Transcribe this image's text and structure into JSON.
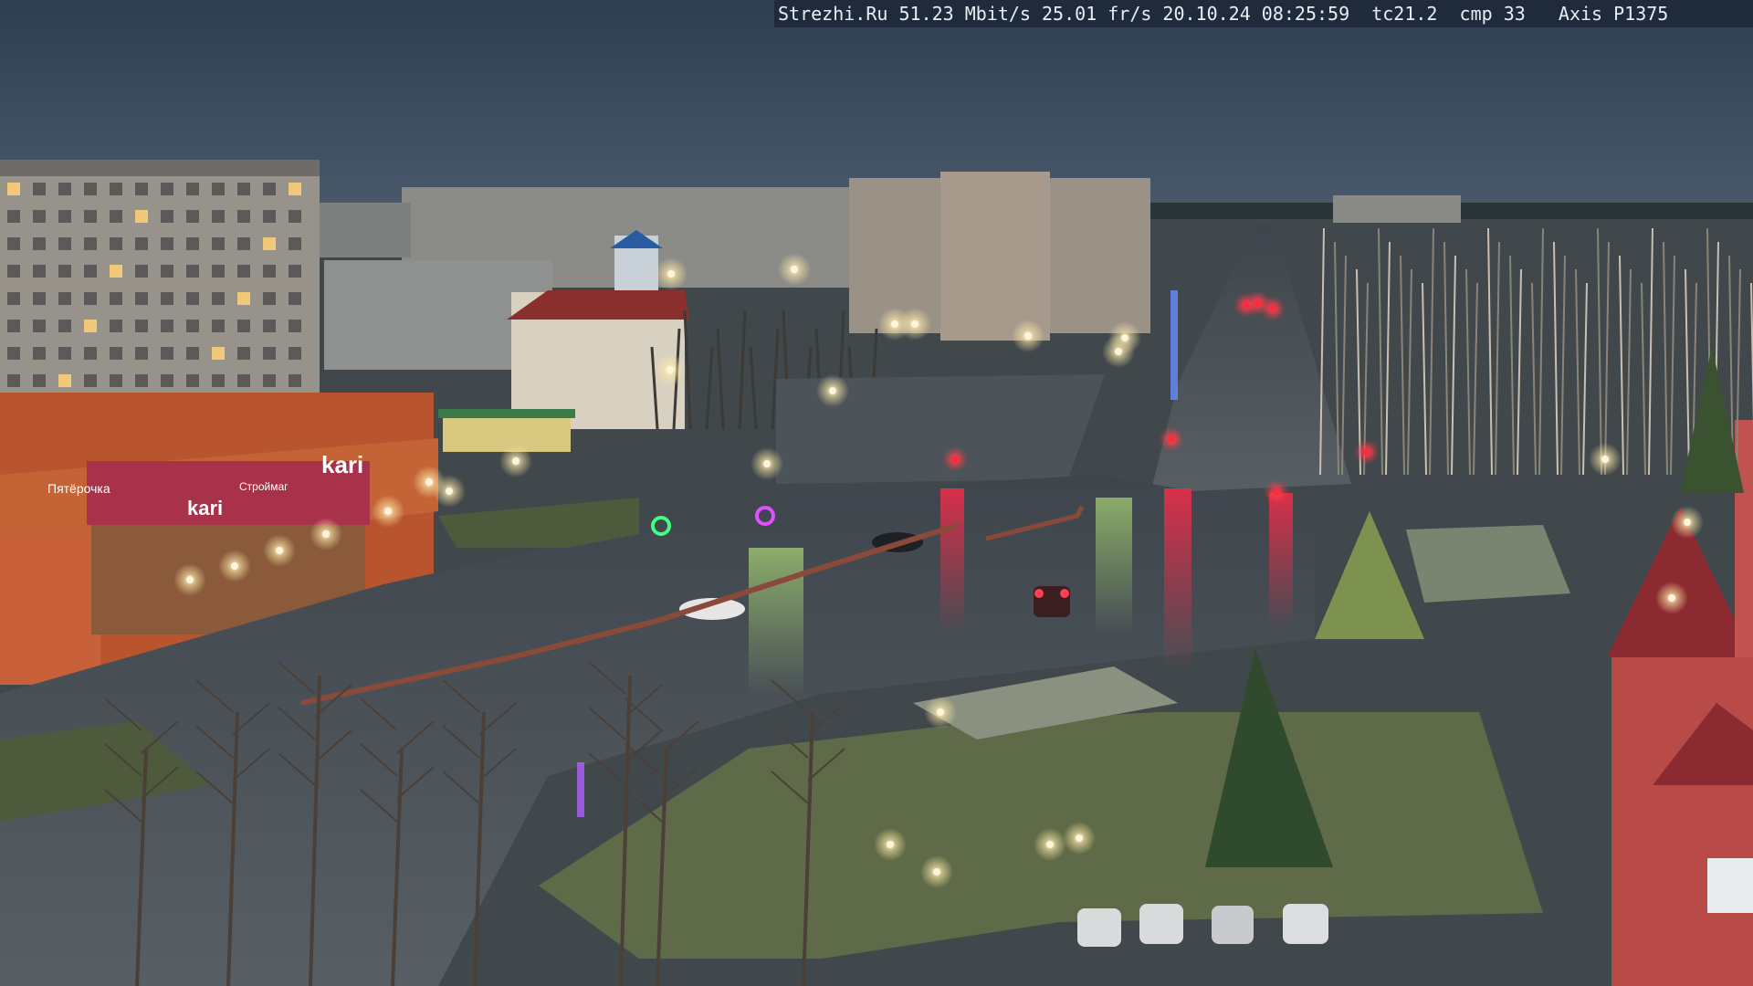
{
  "overlay": {
    "text": "Strezhi.Ru 51.23 Mbit/s 25.01 fr/s 20.10.24 08:25:59  tc21.2  cmp 33   Axis P1375"
  },
  "signs": {
    "store_main": "kari",
    "store_facade": "kari",
    "store_left": "Пятёрочка",
    "store_small": "Строймаг"
  },
  "colors": {
    "sky": "#3a4a5e",
    "road_wet": "#4a5258",
    "grass": "#5f6b48",
    "facade_orange": "#b8552e",
    "brick_red": "#a63a3a",
    "traffic_red": "#ff2a3a",
    "street_lamp": "#fff6d8"
  }
}
